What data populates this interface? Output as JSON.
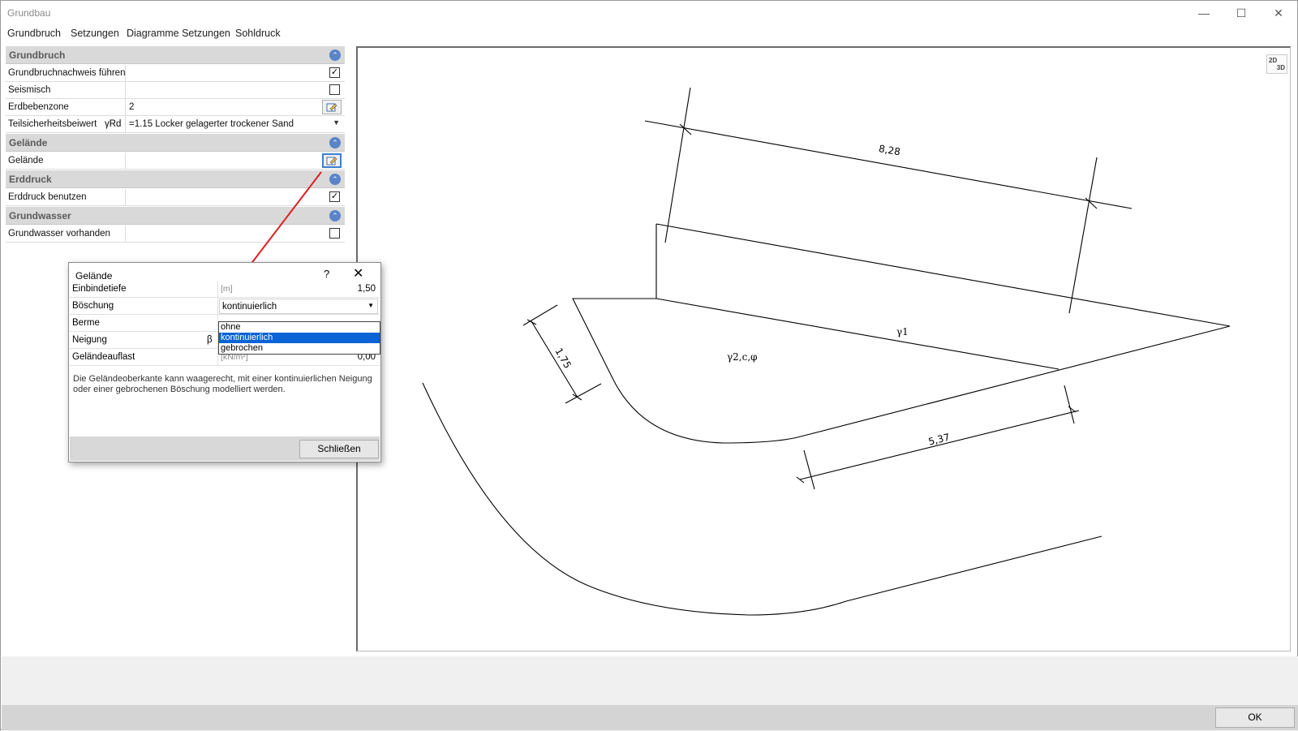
{
  "window": {
    "title": "Grundbau",
    "minimize": "—",
    "maximize": "☐",
    "close": "✕"
  },
  "menu": [
    "Grundbruch",
    "Setzungen",
    "Diagramme Setzungen",
    "Sohldruck"
  ],
  "panel": {
    "sections": [
      {
        "title": "Grundbruch"
      },
      {
        "title": "Gelände"
      },
      {
        "title": "Erddruck"
      },
      {
        "title": "Grundwasser"
      }
    ],
    "rows": {
      "grundbruchnachweis": {
        "label": "Grundbruchnachweis führen",
        "checked": true,
        "check": "✓"
      },
      "seismisch": {
        "label": "Seismisch",
        "checked": false
      },
      "erdbebenzone": {
        "label": "Erdbebenzone",
        "value": "2"
      },
      "teilsicherheit": {
        "label": "Teilsicherheitsbeiwert",
        "symbol": "γRd",
        "value": "=1.15 Locker gelagerter trockener Sand"
      },
      "gelaende": {
        "label": "Gelände"
      },
      "erddruck": {
        "label": "Erddruck benutzen",
        "checked": true,
        "check": "✓"
      },
      "grundwasser": {
        "label": "Grundwasser vorhanden",
        "checked": false
      }
    }
  },
  "view_toggle": {
    "top": "2D",
    "bottom": "3D"
  },
  "drawing": {
    "dim_top": "8,28",
    "dim_left": "1,75",
    "dim_bottom": "5,37",
    "gamma1": "γ1",
    "gamma2": "γ2,c,φ"
  },
  "dialog": {
    "title": "Gelände",
    "help": "?",
    "close": "✕",
    "rows": {
      "einbindetiefe": {
        "label": "Einbindetiefe",
        "unit": "[m]",
        "value": "1,50"
      },
      "boeschung": {
        "label": "Böschung",
        "value": "kontinuierlich"
      },
      "berme": {
        "label": "Berme"
      },
      "neigung": {
        "label": "Neigung",
        "symbol": "β"
      },
      "gelaendeauflast": {
        "label": "Geländeauflast",
        "unit": "[kN/m²]",
        "value": "0,00"
      }
    },
    "dropdown_options": [
      "ohne",
      "kontinuierlich",
      "gebrochen"
    ],
    "selected_option": "kontinuierlich",
    "description": "Die Geländeoberkante kann waagerecht, mit einer kontinuierlichen Neigung oder einer gebrochenen Böschung modelliert werden.",
    "close_button": "Schließen"
  },
  "ok_button": "OK",
  "colors": {
    "accent": "#0a64d6",
    "arrow": "#e02020",
    "section_bg": "#d9d9d9"
  }
}
